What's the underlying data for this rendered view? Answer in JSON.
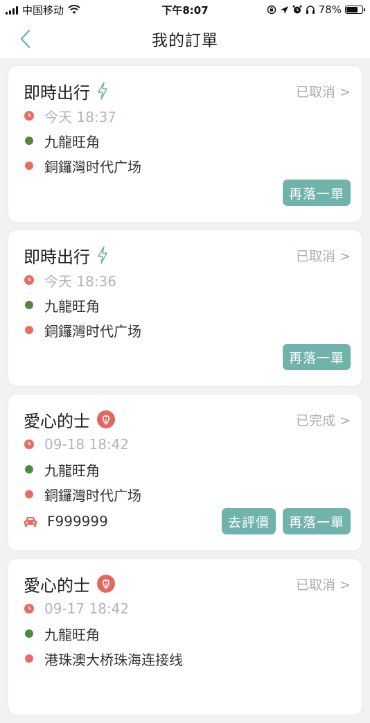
{
  "status_bar": {
    "carrier": "中国移动",
    "time": "下午8:07",
    "battery_pct": "78%",
    "battery_level": 0.78
  },
  "nav": {
    "title": "我的訂單"
  },
  "colors": {
    "accent": "#6fb3aa",
    "status_gray": "#a7abb6",
    "start_dot": "#4e8a3c",
    "end_dot": "#e96b62",
    "clock_red": "#e96b62",
    "love_badge": "#e2685f"
  },
  "orders": [
    {
      "type": "即時出行",
      "type_icon": "lightning-icon",
      "status": "已取消 >",
      "time": "今天 18:37",
      "from": "九龍旺角",
      "to": "銅鑼灣时代广场",
      "buttons": [
        "再落一單"
      ]
    },
    {
      "type": "即時出行",
      "type_icon": "lightning-icon",
      "status": "已取消 >",
      "time": "今天 18:36",
      "from": "九龍旺角",
      "to": "銅鑼灣时代广场",
      "buttons": [
        "再落一單"
      ]
    },
    {
      "type": "愛心的士",
      "type_icon": "love-taxi-icon",
      "status": "已完成 >",
      "time": "09-18 18:42",
      "from": "九龍旺角",
      "to": "銅鑼灣时代广场",
      "plate": "F999999",
      "buttons": [
        "去評價",
        "再落一單"
      ]
    },
    {
      "type": "愛心的士",
      "type_icon": "love-taxi-icon",
      "status": "已取消 >",
      "time": "09-17 18:42",
      "from": "九龍旺角",
      "to": "港珠澳大桥珠海连接线"
    }
  ]
}
